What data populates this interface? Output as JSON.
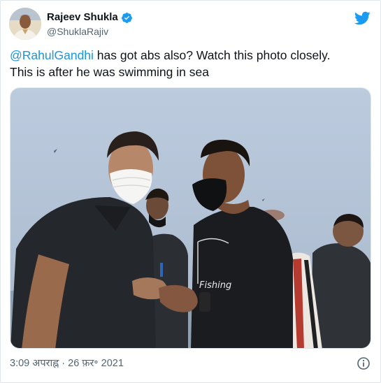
{
  "author": {
    "display_name": "Rajeev Shukla",
    "handle": "@ShuklaRajiv",
    "verified": true
  },
  "tweet": {
    "mention": "@RahulGandhi",
    "text_line1_rest": " has got abs also? Watch this photo closely.",
    "text_line2": "This is after he was swimming in sea",
    "shirt_print": "Fishing"
  },
  "footer": {
    "timestamp": "3:09 अपराह्न · 26 फ़र॰ 2021"
  },
  "icons": {
    "brand": "twitter-bird-icon",
    "verified": "verified-badge-icon",
    "info": "info-icon"
  },
  "colors": {
    "link": "#1b95e0",
    "twitter_blue": "#1d9bf0",
    "secondary_text": "#536471",
    "border": "#e1e8ed"
  }
}
